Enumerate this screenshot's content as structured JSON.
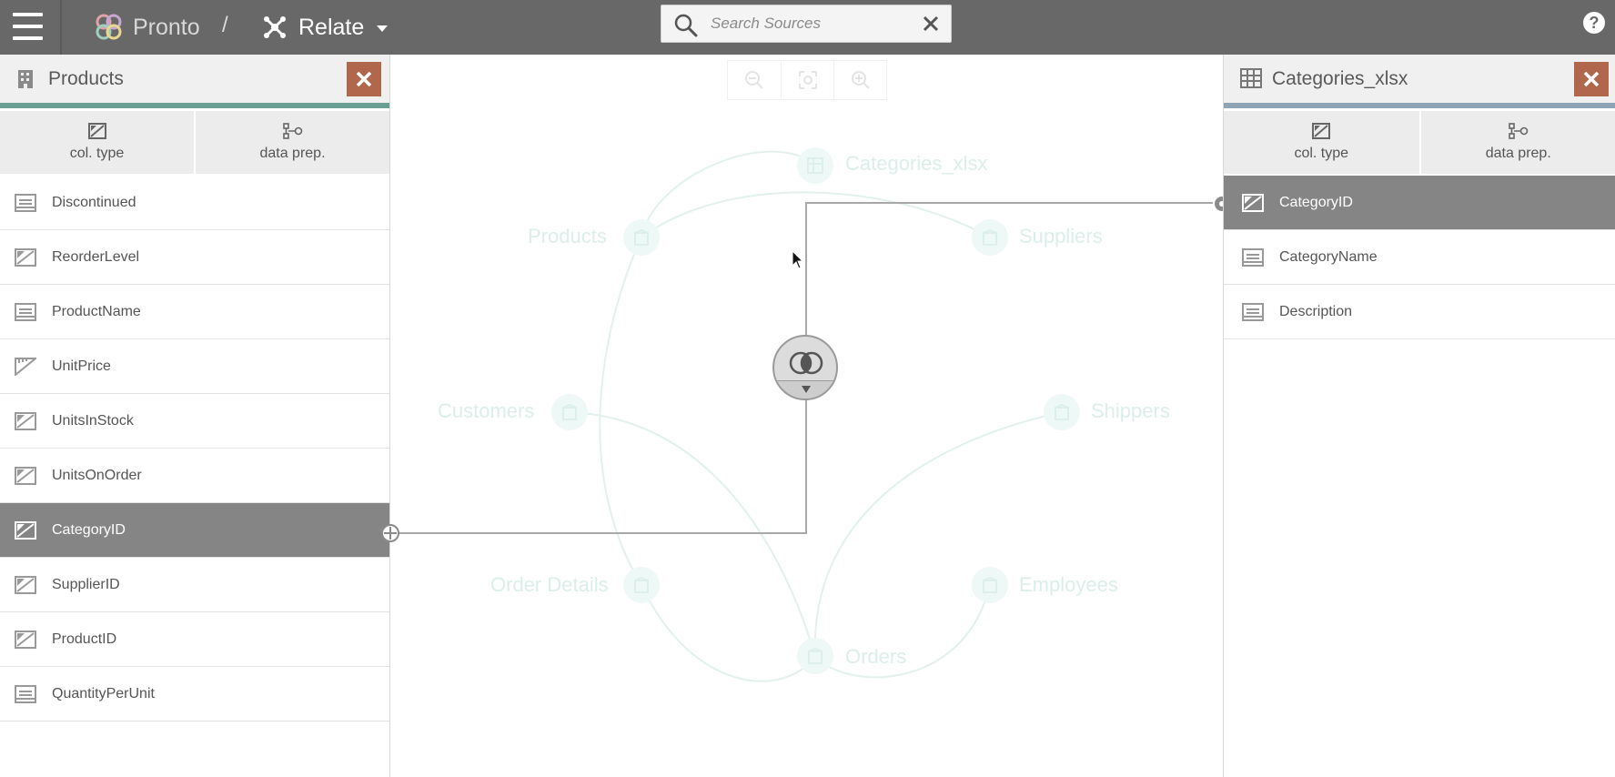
{
  "app": {
    "name": "Pronto",
    "separator": "/",
    "section": "Relate"
  },
  "search": {
    "placeholder": "Search Sources",
    "value": ""
  },
  "help": {
    "label": "?"
  },
  "left_panel": {
    "title": "Products",
    "accent": "#6a9f94",
    "tabs": [
      {
        "label": "col. type",
        "icon": "column-type-icon"
      },
      {
        "label": "data prep.",
        "icon": "data-prep-icon"
      }
    ],
    "fields": [
      {
        "label": "Discontinued",
        "type": "text"
      },
      {
        "label": "ReorderLevel",
        "type": "number"
      },
      {
        "label": "ProductName",
        "type": "text"
      },
      {
        "label": "UnitPrice",
        "type": "measure"
      },
      {
        "label": "UnitsInStock",
        "type": "number"
      },
      {
        "label": "UnitsOnOrder",
        "type": "number"
      },
      {
        "label": "CategoryID",
        "type": "number",
        "selected": true
      },
      {
        "label": "SupplierID",
        "type": "number"
      },
      {
        "label": "ProductID",
        "type": "number"
      },
      {
        "label": "QuantityPerUnit",
        "type": "text"
      }
    ]
  },
  "right_panel": {
    "title": "Categories_xlsx",
    "accent": "#8ea4b5",
    "tabs": [
      {
        "label": "col. type",
        "icon": "column-type-icon"
      },
      {
        "label": "data prep.",
        "icon": "data-prep-icon"
      }
    ],
    "fields": [
      {
        "label": "CategoryID",
        "type": "number",
        "selected": true
      },
      {
        "label": "CategoryName",
        "type": "text"
      },
      {
        "label": "Description",
        "type": "text"
      }
    ]
  },
  "graph": {
    "nodes": [
      {
        "label": "Categories_xlsx"
      },
      {
        "label": "Products"
      },
      {
        "label": "Suppliers"
      },
      {
        "label": "Customers"
      },
      {
        "label": "Shippers"
      },
      {
        "label": "Order Details"
      },
      {
        "label": "Employees"
      },
      {
        "label": "Orders"
      }
    ],
    "zoom_controls": [
      "zoom-out",
      "fit-to-screen",
      "zoom-in"
    ],
    "join_type": "inner"
  },
  "colors": {
    "topbar": "#686868",
    "selected_row": "#858585",
    "close_button": "#b0674c",
    "node_faded": "#dbeeea"
  }
}
